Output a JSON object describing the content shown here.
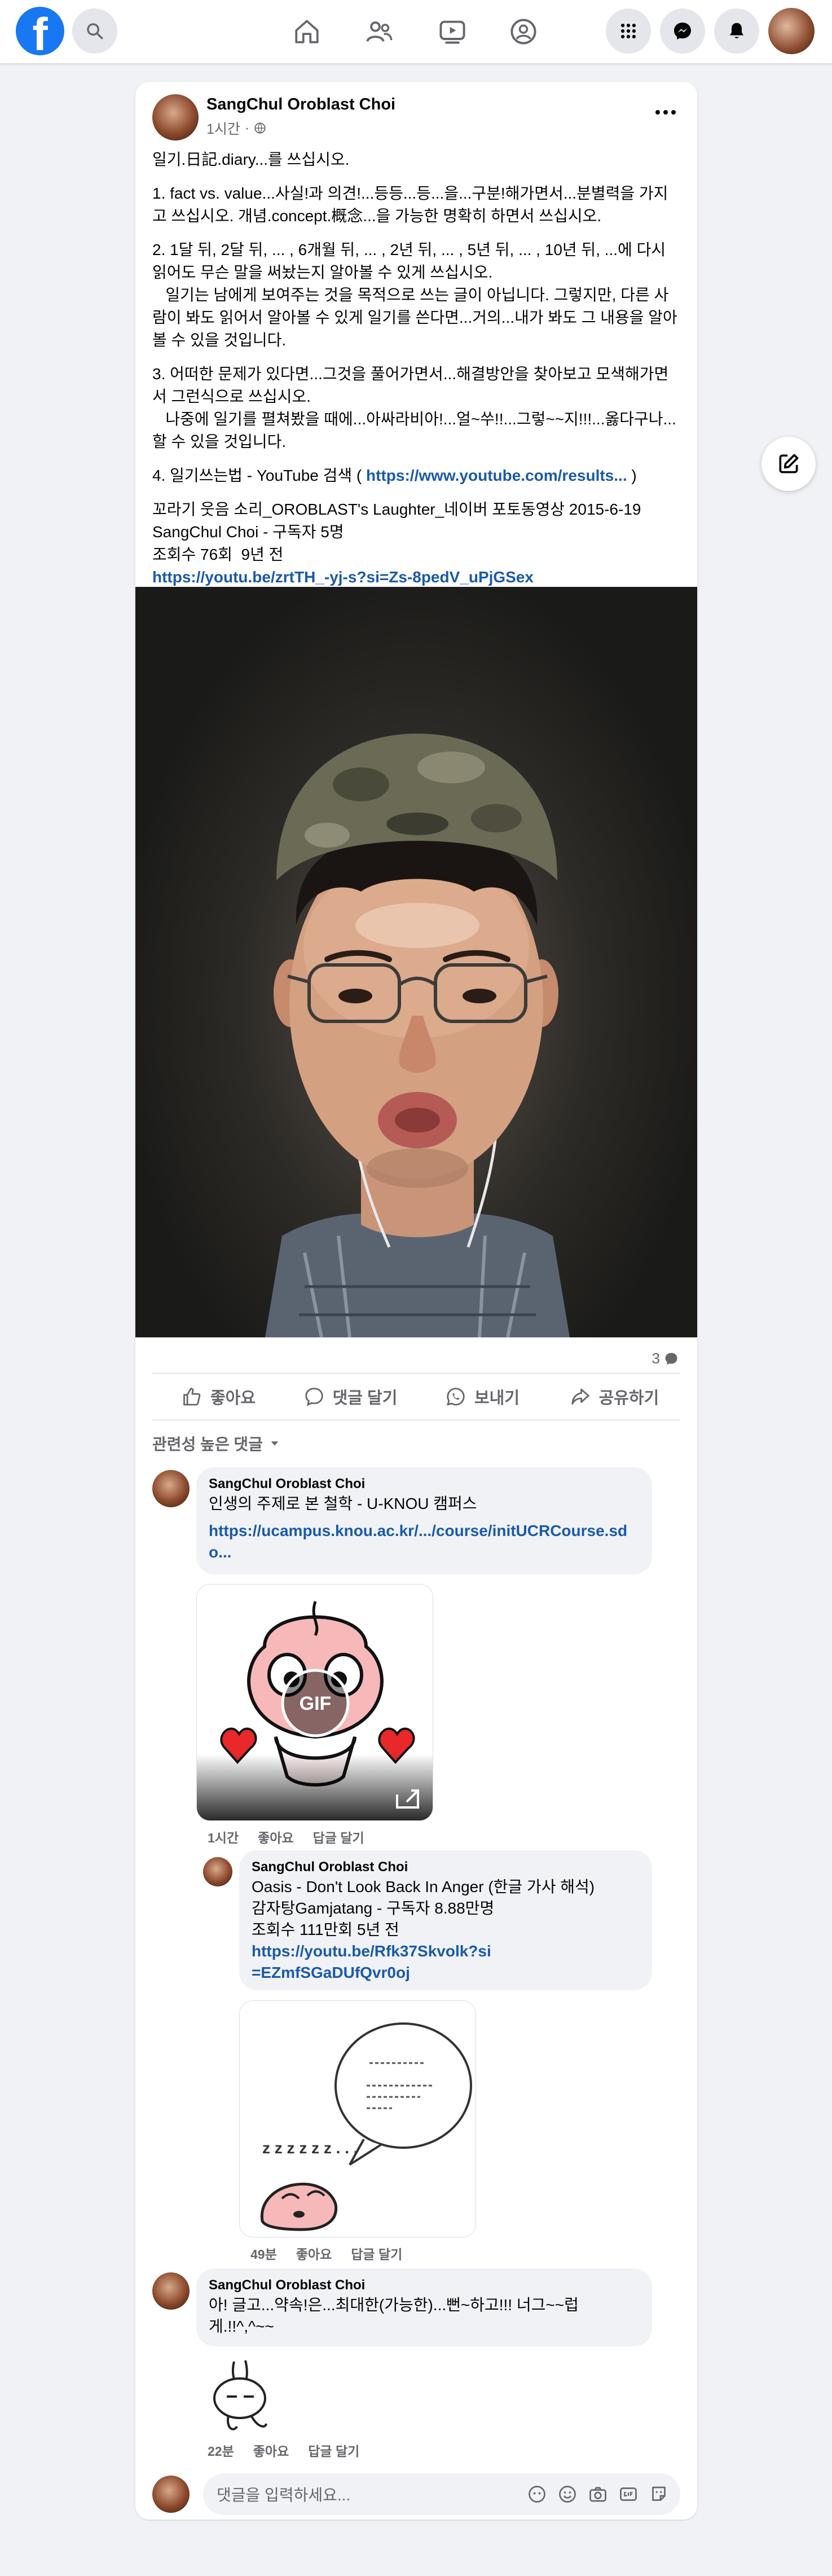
{
  "nav": {
    "logo": "f",
    "search_icon": "search-icon",
    "icons": [
      "home-icon",
      "friends-icon",
      "video-icon",
      "groups-icon",
      "menu-grid-icon",
      "messenger-icon",
      "notifications-icon"
    ]
  },
  "post": {
    "author": "SangChul Oroblast Choi",
    "time": "1시간",
    "privacy_icon": "globe-icon",
    "paragraphs": [
      "일기.日記.diary...를 쓰십시오.",
      "1. fact vs. value...사실!과 의견!...등등...등...을...구분!해가면서...분별력을 가지고 쓰십시오. 개념.concept.概念...을 가능한 명확히 하면서 쓰십시오.",
      "2. 1달 뒤, 2달 뒤, ... , 6개월 뒤, ... , 2년 뒤, ... , 5년 뒤, ... , 10년 뒤, ...에 다시 읽어도 무슨 말을 써놨는지 알아볼 수 있게 쓰십시오.\n   일기는 남에게 보여주는 것을 목적으로 쓰는 글이 아닙니다. 그렇지만, 다른 사람이 봐도 읽어서 알아볼 수 있게 일기를 쓴다면...거의...내가 봐도 그 내용을 알아볼 수 있을 것입니다.",
      "3. 어떠한 문제가 있다면...그것을 풀어가면서...해결방안을 찾아보고 모색해가면서 그런식으로 쓰십시오.\n   나중에 일기를 펼쳐봤을 때에...아싸라비아!...얼~쑤!!...그렇~~지!!!...옳다구나...할 수 있을 것입니다."
    ],
    "p4_prefix": "4. 일기쓰는법 - YouTube 검색 ( ",
    "p4_link": "https://www.youtube.com/results...",
    "p4_suffix": " )",
    "video_title": "꼬라기 웃음 소리_OROBLAST's Laughter_네이버 포토동영상 2015-6-19",
    "video_channel": "SangChul Choi - 구독자 5명",
    "video_stats": "조회수 76회  9년 전",
    "video_link": "https://youtu.be/zrtTH_-yj-s?si=Zs-8pedV_uPjGSex",
    "reaction_count": "3",
    "actions": {
      "like": "좋아요",
      "comment": "댓글 달기",
      "send": "보내기",
      "share": "공유하기"
    },
    "sort_label": "관련성 높은 댓글"
  },
  "comments": [
    {
      "author": "SangChul Oroblast Choi",
      "text": "인생의 주제로 본 철학 - U-KNOU 캠퍼스",
      "link": "https://ucampus.knou.ac.kr/.../course/initUCRCourse.sdo...",
      "gif_label": "GIF",
      "time": "1시간",
      "like": "좋아요",
      "reply": "답글 달기"
    },
    {
      "author": "SangChul Oroblast Choi",
      "lines": [
        "Oasis - Don't Look Back In Anger (한글 가사 해석)",
        "감자탕Gamjatang - 구독자 8.88만명",
        "조회수 111만회 5년 전"
      ],
      "link": "https://youtu.be/Rfk37Skvolk?si=EZmfSGaDUfQvr0oj",
      "sticker_text": "z z z z z z . . .",
      "time": "49분",
      "like": "좋아요",
      "reply": "답글 달기"
    },
    {
      "author": "SangChul Oroblast Choi",
      "text": "아! 글고...약속!은...최대한(가능한)...뻔~하고!!! 너그~~럽게.!!^,^~~",
      "time": "22분",
      "like": "좋아요",
      "reply": "답글 달기"
    }
  ],
  "composer": {
    "placeholder": "댓글을 입력하세요..."
  },
  "colors": {
    "brand": "#1877f2",
    "link": "#1a5aa8",
    "muted": "#65676b",
    "background": "#f0f2f5"
  }
}
